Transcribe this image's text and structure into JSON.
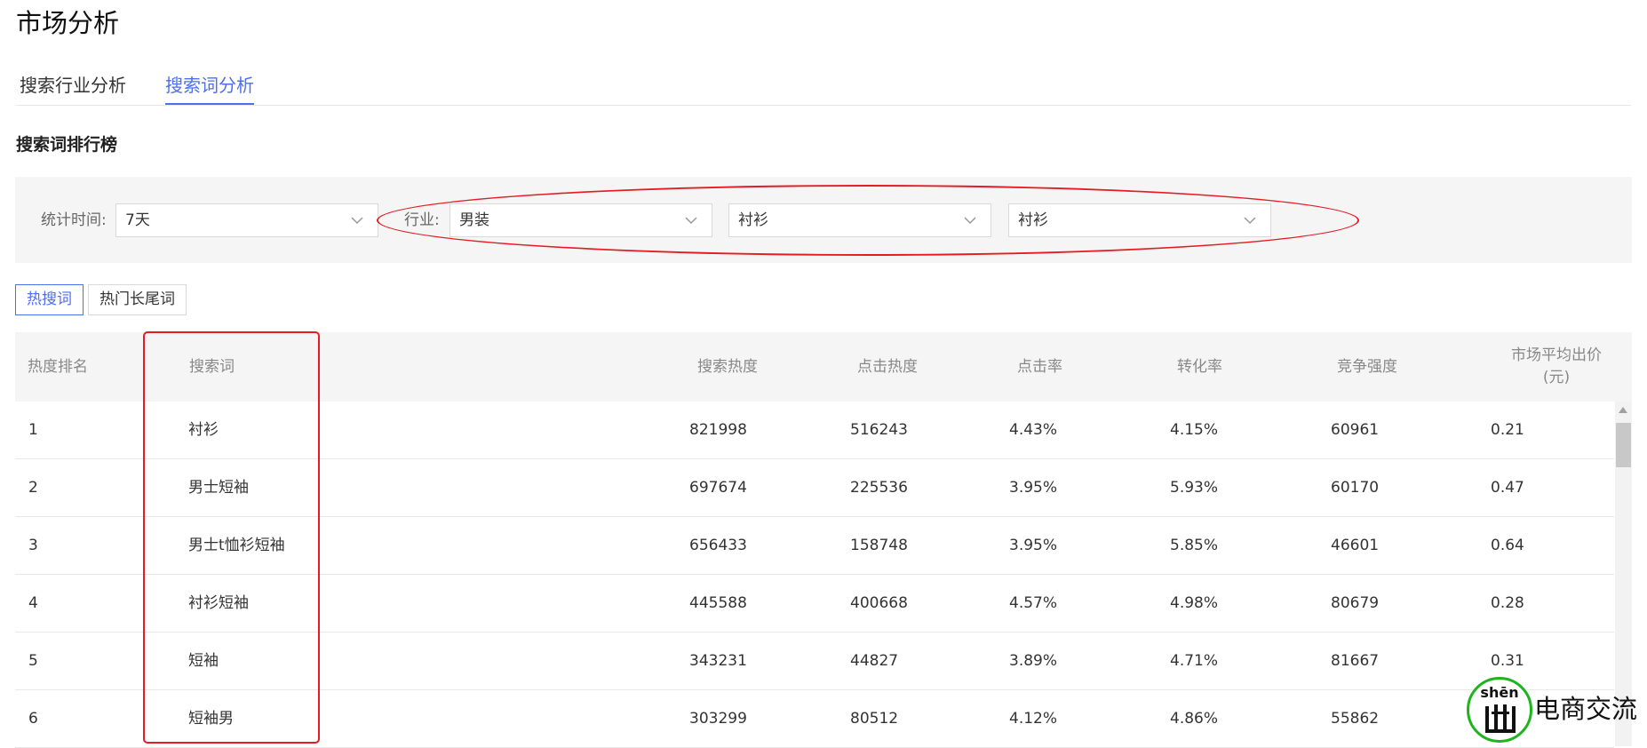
{
  "page": {
    "title": "市场分析"
  },
  "tabs": [
    {
      "label": "搜索行业分析",
      "active": false
    },
    {
      "label": "搜索词分析",
      "active": true
    }
  ],
  "section": {
    "title": "搜索词排行榜"
  },
  "filters": {
    "time_label": "统计时间:",
    "time_value": "7天",
    "industry_label": "行业:",
    "industry_value": "男装",
    "category_value": "衬衫",
    "subcategory_value": "衬衫"
  },
  "subtabs": [
    {
      "label": "热搜词",
      "active": true
    },
    {
      "label": "热门长尾词",
      "active": false
    }
  ],
  "table": {
    "columns": {
      "rank": "热度排名",
      "keyword": "搜索词",
      "search_heat": "搜索热度",
      "click_heat": "点击热度",
      "ctr": "点击率",
      "conversion": "转化率",
      "competition": "竞争强度",
      "avg_bid_line1": "市场平均出价",
      "avg_bid_line2": "(元)"
    },
    "rows": [
      {
        "rank": "1",
        "keyword": "衬衫",
        "search_heat": "821998",
        "click_heat": "516243",
        "ctr": "4.43%",
        "conversion": "4.15%",
        "competition": "60961",
        "avg_bid": "0.21"
      },
      {
        "rank": "2",
        "keyword": "男士短袖",
        "search_heat": "697674",
        "click_heat": "225536",
        "ctr": "3.95%",
        "conversion": "5.93%",
        "competition": "60170",
        "avg_bid": "0.47"
      },
      {
        "rank": "3",
        "keyword": "男士t恤衫短袖",
        "search_heat": "656433",
        "click_heat": "158748",
        "ctr": "3.95%",
        "conversion": "5.85%",
        "competition": "46601",
        "avg_bid": "0.64"
      },
      {
        "rank": "4",
        "keyword": "衬衫短袖",
        "search_heat": "445588",
        "click_heat": "400668",
        "ctr": "4.57%",
        "conversion": "4.98%",
        "competition": "80679",
        "avg_bid": "0.28"
      },
      {
        "rank": "5",
        "keyword": "短袖",
        "search_heat": "343231",
        "click_heat": "44827",
        "ctr": "3.89%",
        "conversion": "4.71%",
        "competition": "81667",
        "avg_bid": "0.31"
      },
      {
        "rank": "6",
        "keyword": "短袖男",
        "search_heat": "303299",
        "click_heat": "80512",
        "ctr": "4.12%",
        "conversion": "4.86%",
        "competition": "55862",
        "avg_bid": ""
      }
    ]
  },
  "watermark": {
    "pinyin": "shēn",
    "text": "电商交流"
  },
  "icons": {
    "dropdown": "chevron-down-icon",
    "scroll": "scroll-up-arrow-icon"
  },
  "colors": {
    "accent": "#4e6ef2",
    "annotation": "#e51c23",
    "watermark": "#1db41d"
  }
}
